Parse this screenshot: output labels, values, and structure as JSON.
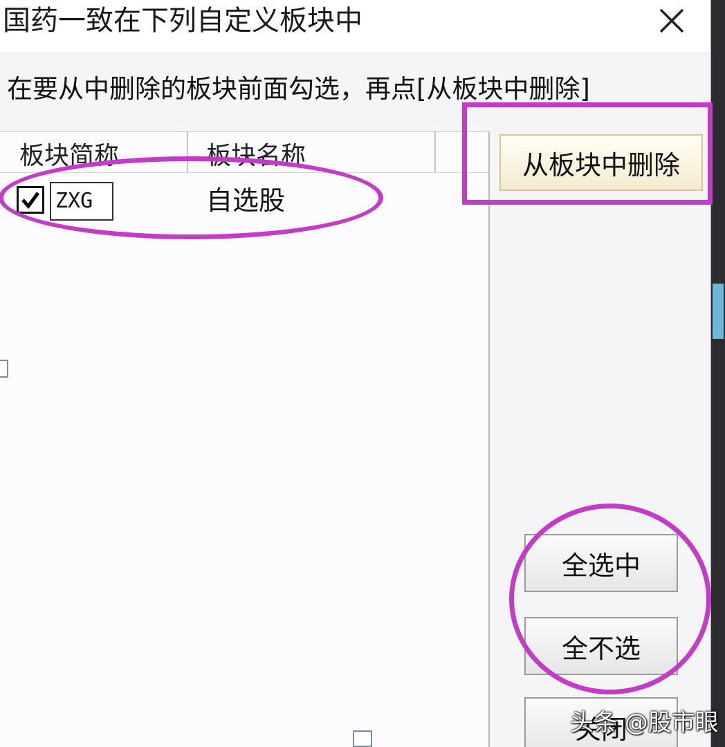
{
  "dialog": {
    "title": "国药一致在下列自定义板块中",
    "close_icon": "close-icon",
    "instruction": "在要从中删除的板块前面勾选，再点[从板块中删除]"
  },
  "list": {
    "columns": [
      "板块简称",
      "板块名称",
      ""
    ],
    "rows": [
      {
        "checked": true,
        "code": "ZXG",
        "name": "自选股"
      }
    ]
  },
  "buttons": {
    "delete": "从板块中删除",
    "select_all": "全选中",
    "select_none": "全不选",
    "close": "关闭"
  },
  "annotations": {
    "highlight_color": "#c23cc6"
  },
  "watermark": "头条 @股市眼"
}
